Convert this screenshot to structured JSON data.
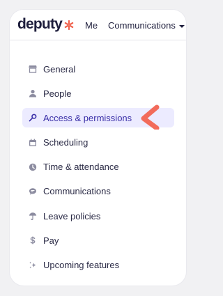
{
  "header": {
    "logo_text": "deputy",
    "nav_me": "Me",
    "nav_communications": "Communications"
  },
  "menu": {
    "active_index": 2,
    "items": [
      {
        "label": "General",
        "icon": "store-icon"
      },
      {
        "label": "People",
        "icon": "person-icon"
      },
      {
        "label": "Access & permissions",
        "icon": "key-icon"
      },
      {
        "label": "Scheduling",
        "icon": "calendar-icon"
      },
      {
        "label": "Time & attendance",
        "icon": "clock-icon"
      },
      {
        "label": "Communications",
        "icon": "chat-icon"
      },
      {
        "label": "Leave policies",
        "icon": "umbrella-icon"
      },
      {
        "label": "Pay",
        "icon": "dollar-icon"
      },
      {
        "label": "Upcoming features",
        "icon": "sparkle-icon"
      }
    ]
  },
  "colors": {
    "accent": "#3a2fa8",
    "active_bg": "#ecebff",
    "pointer": "#f26b5b",
    "logo_mark": "#f0624d"
  }
}
